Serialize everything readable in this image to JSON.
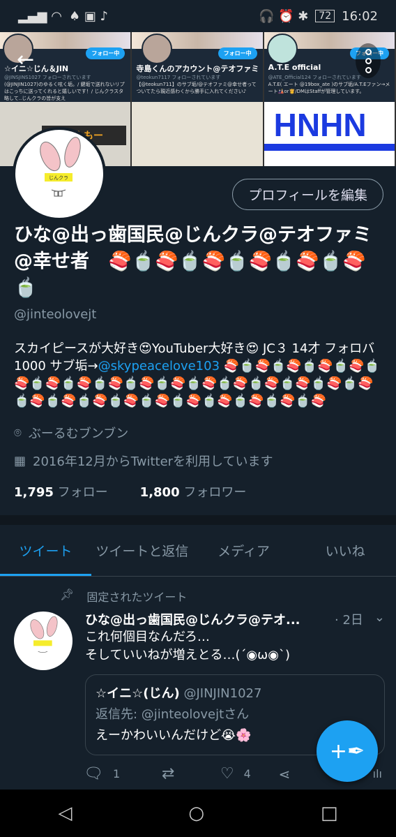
{
  "status_bar": {
    "signal": "4G",
    "battery": "72",
    "time": "16:02"
  },
  "banner": {
    "cards": [
      {
        "name": "☆イニ☆じん＆JIN",
        "handle": "@JINSJINS1027 フォローされています",
        "bio": "(@JINJIN1027)のゆるく呟く垢。/ 鍵垢で送れないリプはこっちに送ってくれると嬉しいです！/ じんクラスタ略して..じんクラの皆が支え",
        "follow": "フォロー中"
      },
      {
        "name": "寺島くんのアカウント@テオファミ",
        "handle": "@teokun7117 フォローされています",
        "bio": "【@teokun711】のサブ垢/@テオファミ@幸せ者ってついてたら親近感わくから勝手に入れてください♪",
        "follow": "フォロー中"
      },
      {
        "name": "A.T.E official",
        "handle": "@ATE_Official124 フォローされています",
        "bio": "A.T.E( エート @19box_ate )のサブ垢/A.T.Eファン→メート🎎or👸/DMはStaffが管理しています。",
        "follow": "フォロー中"
      }
    ],
    "sign_text": "まんまんもー",
    "hnhn_text": "HNHN"
  },
  "profile": {
    "edit_button": "プロフィールを編集",
    "name": "ひな@出っ歯国民@じんクラ@テオファミ@幸せ者　🍣🍵🍣🍵🍣🍵🍣🍵🍣🍵🍣🍵",
    "handle": "@jinteolovejt",
    "bio_text": "スカイピースが大好き😍YouTuber大好き😍 JC３ 14才 フォロバ1000 サブ垢→",
    "bio_link": "@skypeacelove103",
    "bio_emoji": " 🍣🍵🍣🍵🍣🍵🍣🍵🍣🍵🍣🍵🍣🍵🍣🍵🍣🍵🍣🍵🍣🍵🍣🍵🍣🍵🍣🍵🍣🍵🍣🍵🍣🍵🍣🍵🍣🍵🍣🍵🍣🍵🍣🍵🍣🍵🍣🍵🍣🍵🍣🍵🍣",
    "location": "ぶーるむブンブン",
    "joined": "2016年12月からTwitterを利用しています",
    "following_count": "1,795",
    "following_label": "フォロー",
    "followers_count": "1,800",
    "followers_label": "フォロワー",
    "avatar_label": "じんクラ"
  },
  "tabs": [
    "ツイート",
    "ツイートと返信",
    "メディア",
    "いいね"
  ],
  "tweet": {
    "pinned_label": "固定されたツイート",
    "author": "ひな@出っ歯国民@じんクラ@テオ...",
    "time": "· 2日",
    "line1": "これ何個目なんだろ…",
    "line2": "そしていいねが増えとる…(´◉ω◉`)",
    "quote": {
      "name": "☆イニ☆(じん)",
      "handle": "@JINJIN1027",
      "reply_to": "返信先: @jinteolovejtさん",
      "text": "えーかわいいんだけど😭🌸"
    },
    "replies": "1",
    "likes": "4"
  },
  "colors": {
    "bg": "#15202b",
    "accent": "#1da1f2"
  }
}
